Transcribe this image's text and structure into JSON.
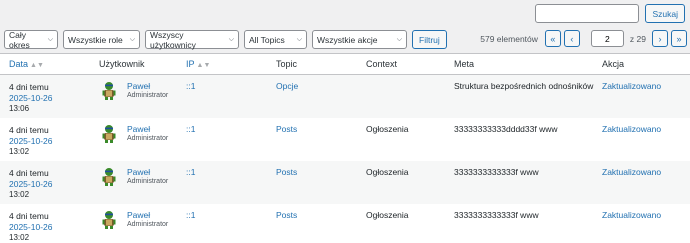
{
  "search": {
    "placeholder": "",
    "button": "Szukaj"
  },
  "filters": [
    {
      "label": "Cały okres"
    },
    {
      "label": "Wszystkie role"
    },
    {
      "label": "Wszyscy użytkownicy"
    },
    {
      "label": "All Topics"
    },
    {
      "label": "Wszystkie akcje"
    }
  ],
  "filter_button": "Filtruj",
  "pagination": {
    "count": "579 elementów",
    "first": "«",
    "prev": "‹",
    "current": "2",
    "of": "z 29",
    "next": "›",
    "last": "»"
  },
  "table": {
    "headers": {
      "date": "Data",
      "user": "Użytkownik",
      "ip": "IP",
      "topic": "Topic",
      "context": "Context",
      "meta": "Meta",
      "action": "Akcja"
    },
    "rows": [
      {
        "rel": "4 dni temu",
        "date": "2025-10-26",
        "time": "13:06",
        "user": "Paweł",
        "role": "Administrator",
        "ip": "::1",
        "topic": "Opcje",
        "context": "",
        "meta": "Struktura bezpośrednich odnośników",
        "action": "Zaktualizowano"
      },
      {
        "rel": "4 dni temu",
        "date": "2025-10-26",
        "time": "13:02",
        "user": "Paweł",
        "role": "Administrator",
        "ip": "::1",
        "topic": "Posts",
        "context": "Ogłoszenia",
        "meta": "33333333333dddd33f www",
        "action": "Zaktualizowano"
      },
      {
        "rel": "4 dni temu",
        "date": "2025-10-26",
        "time": "13:02",
        "user": "Paweł",
        "role": "Administrator",
        "ip": "::1",
        "topic": "Posts",
        "context": "Ogłoszenia",
        "meta": "3333333333333f www",
        "action": "Zaktualizowano"
      },
      {
        "rel": "4 dni temu",
        "date": "2025-10-26",
        "time": "13:02",
        "user": "Paweł",
        "role": "Administrator",
        "ip": "::1",
        "topic": "Posts",
        "context": "Ogłoszenia",
        "meta": "3333333333333f www",
        "action": "Zaktualizowano"
      }
    ]
  },
  "colors": {
    "link": "#2271b1",
    "row_alt": "#f6f7f7",
    "background": "#f0f0f1"
  }
}
